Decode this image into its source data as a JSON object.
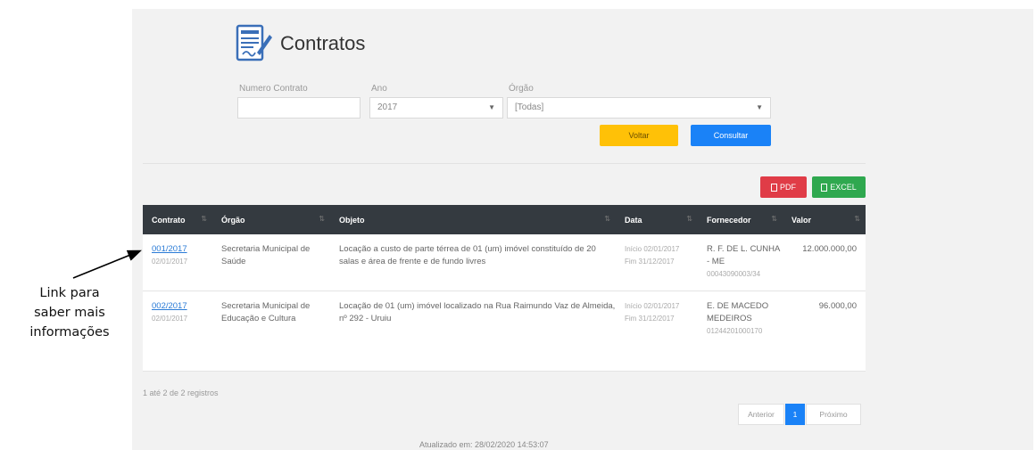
{
  "header": {
    "title": "Contratos",
    "logo_icon": "contract-document-icon"
  },
  "filters": {
    "numero_label": "Numero Contrato",
    "numero_value": "",
    "ano_label": "Ano",
    "ano_value": "2017",
    "orgao_label": "Órgão",
    "orgao_value": "[Todas]"
  },
  "buttons": {
    "voltar": "Voltar",
    "consultar": "Consultar",
    "pdf": "PDF",
    "excel": "EXCEL"
  },
  "table": {
    "headers": [
      "Contrato",
      "Órgão",
      "Objeto",
      "Data",
      "Fornecedor",
      "Valor"
    ],
    "rows": [
      {
        "contrato": "001/2017",
        "contrato_date": "02/01/2017",
        "orgao": "Secretaria Municipal de Saúde",
        "objeto": "Locação a custo de parte térrea de 01 (um) imóvel constituído de 20 salas e área de frente e de fundo livres",
        "data_inicio": "Início 02/01/2017",
        "data_fim": "Fim 31/12/2017",
        "fornecedor": "R. F. DE L. CUNHA - ME",
        "fornecedor_doc": "00043090003/34",
        "valor": "12.000.000,00"
      },
      {
        "contrato": "002/2017",
        "contrato_date": "02/01/2017",
        "orgao": "Secretaria Municipal de Educação e Cultura",
        "objeto": "Locação de 01 (um) imóvel localizado na Rua Raimundo Vaz de Almeida, nº 292 - Uruiu",
        "data_inicio": "Início 02/01/2017",
        "data_fim": "Fim 31/12/2017",
        "fornecedor": "E. DE MACEDO MEDEIROS",
        "fornecedor_doc": "01244201000170",
        "valor": "96.000,00"
      }
    ]
  },
  "records_info": "1 até 2 de 2 registros",
  "pagination": {
    "prev": "Anterior",
    "current": "1",
    "next": "Próximo"
  },
  "footer": "Atualizado em: 28/02/2020 14:53:07",
  "annotation": {
    "line1": "Link para",
    "line2": "saber mais",
    "line3": "informações"
  },
  "colors": {
    "header_bg": "#343a40",
    "link": "#2a7bd6",
    "yellow": "#ffc107",
    "blue": "#1a82f7",
    "red": "#e03c47",
    "green": "#2fa84f"
  }
}
